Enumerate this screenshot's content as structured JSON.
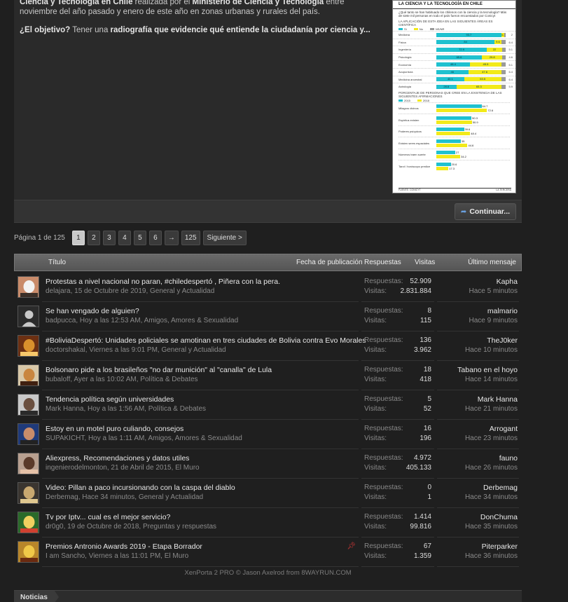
{
  "article": {
    "p1_bold_a": "Ciencia y Tecnología en Chile",
    "p1_text_a": " realizada por el ",
    "p1_bold_b": "Ministerio de Ciencia y Tecnología",
    "p1_text_b": " entre noviembre del año pasado y enero de este año en zonas urbanas y rurales del país.",
    "p2_bold_a": "¿El objetivo?",
    "p2_text_a": " Tener una ",
    "p2_bold_b": "radiografía que evidencie qué entiende la ciudadanía por ciencia y...",
    "infographic": {
      "title": "LA CIENCIA Y LA TECNOLOGÍA EN CHILE",
      "question": "¿Qué tanto se han habituado los chilenos con la ciencia y la tecnología? Más de siete mil personas en todo el país fueron encuestados por Conicyt",
      "section1": "LA APLICACIÓN DE ESTA IDEA EN LAS SIGUIENTES ÁREAS ES CIENTÍFICA",
      "legend": [
        "Sí",
        "No",
        "NS/NR"
      ],
      "rows": [
        {
          "label": "Medicina",
          "si": "93.7",
          "no": "4.3",
          "ns": "2"
        },
        {
          "label": "Física",
          "si": "84",
          "no": "9.6",
          "ns": "6.4"
        },
        {
          "label": "Ingeniería",
          "si": "72.9",
          "no": "22",
          "ns": "5.1"
        },
        {
          "label": "Psicología",
          "si": "65.6",
          "no": "29.8",
          "ns": "4.6"
        },
        {
          "label": "Economía",
          "si": "48.4",
          "no": "45.5",
          "ns": "6.1"
        },
        {
          "label": "Acupuntura",
          "si": "46",
          "no": "47.6",
          "ns": "6.4"
        },
        {
          "label": "Medicina ancestral",
          "si": "40.1",
          "no": "53.5",
          "ns": "6.4"
        },
        {
          "label": "Astrología",
          "si": "28.8",
          "no": "65.3",
          "ns": "5.9"
        }
      ],
      "section2": "PORCENTAJE DE PERSONAS QUE CREE EN LA EXISTENCIA DE LAS SIGUIENTES AFIRMACIONES",
      "legend2": [
        "2015",
        "2018"
      ],
      "beliefs": [
        {
          "label": "Milagros divinos",
          "a": "64.7",
          "b": "72.6"
        },
        {
          "label": "Espíritus existen",
          "a": "50.3",
          "b": "50.9"
        },
        {
          "label": "Poderes psíquicos",
          "a": "39.6",
          "b": "48.4"
        },
        {
          "label": "Existen seres espaciales",
          "a": "35",
          "b": "44.6"
        },
        {
          "label": "Números traen suerte",
          "a": "27",
          "b": "34.2"
        },
        {
          "label": "Tarot / horóscopo predice",
          "a": "20.6",
          "b": "17.3"
        }
      ],
      "foot_left": "FUENTE: CONICYT",
      "foot_right": "LA TERCERA"
    }
  },
  "actions": {
    "continue_label": "Continuar..."
  },
  "pager": {
    "label": "Página 1 de 125",
    "pages": [
      "1",
      "2",
      "3",
      "4",
      "5",
      "6"
    ],
    "arrow": "→",
    "last": "125",
    "next": "Siguiente >"
  },
  "table": {
    "headers": {
      "title": "Título",
      "date": "Fecha de publicación",
      "replies": "Respuestas",
      "views": "Visitas",
      "last": "Último mensaje"
    },
    "replies_label": "Respuestas:",
    "views_label": "Visitas:",
    "threads": [
      {
        "title": "Protestas a nivel nacional no paran, #chiledespertó , Piñera con la pera.",
        "meta": "delajara, 15 de Octubre de 2019, General y Actualidad",
        "replies": "52.909",
        "views": "2.831.884",
        "last_user": "Kapha",
        "last_time": "Hace 5 minutos",
        "pinned": false
      },
      {
        "title": "Se han vengado de alguien?",
        "meta": "badpucca, Hoy a las 12:53 AM, Amigos, Amores & Sexualidad",
        "replies": "8",
        "views": "115",
        "last_user": "malmario",
        "last_time": "Hace 9 minutos",
        "pinned": false
      },
      {
        "title": "#BoliviaDespertó: Unidades policiales se amotinan en tres ciudades de Bolivia contra Evo Morales",
        "meta": "doctorshakal, Viernes a las 9:01 PM, General y Actualidad",
        "replies": "136",
        "views": "3.962",
        "last_user": "TheJ0ker",
        "last_time": "Hace 10 minutos",
        "pinned": false
      },
      {
        "title": "Bolsonaro pide a los brasileños \"no dar munición\" al \"canalla\" de Lula",
        "meta": "bubaloff, Ayer a las 10:02 AM, Política & Debates",
        "replies": "18",
        "views": "418",
        "last_user": "Tabano en el hoyo",
        "last_time": "Hace 14 minutos",
        "pinned": false
      },
      {
        "title": "Tendencia política según universidades",
        "meta": "Mark Hanna, Hoy a las 1:56 AM, Política & Debates",
        "replies": "5",
        "views": "52",
        "last_user": "Mark Hanna",
        "last_time": "Hace 21 minutos",
        "pinned": false
      },
      {
        "title": "Estoy en un motel puro culiando, consejos",
        "meta": "SUPAKICHT, Hoy a las 1:11 AM, Amigos, Amores & Sexualidad",
        "replies": "16",
        "views": "196",
        "last_user": "Arrogant",
        "last_time": "Hace 23 minutos",
        "pinned": false
      },
      {
        "title": "Aliexpress, Recomendaciones y datos utiles",
        "meta": "ingenierodelmonton, 21 de Abril de 2015, El Muro",
        "replies": "4.972",
        "views": "405.133",
        "last_user": "fauno",
        "last_time": "Hace 26 minutos",
        "pinned": false
      },
      {
        "title": "Video: Pillan a paco incursionando con la caspa del diablo",
        "meta": "Derbemag, Hace 34 minutos, General y Actualidad",
        "replies": "0",
        "views": "1",
        "last_user": "Derbemag",
        "last_time": "Hace 34 minutos",
        "pinned": false
      },
      {
        "title": "Tv por Iptv... cual es el mejor servicio?",
        "meta": "dr0g0, 19 de Octubre de 2018, Preguntas y respuestas",
        "replies": "1.414",
        "views": "99.816",
        "last_user": "DonChuma",
        "last_time": "Hace 35 minutos",
        "pinned": false
      },
      {
        "title": "Premios Antronio Awards 2019 - Etapa Borrador",
        "meta": "I am Sancho, Viernes a las 11:01 PM, El Muro",
        "replies": "67",
        "views": "1.359",
        "last_user": "Piterparker",
        "last_time": "Hace 36 minutos",
        "pinned": true
      }
    ]
  },
  "footer": {
    "credit": "XenPorta 2 PRO © Jason Axelrod from 8WAYRUN.COM"
  },
  "tabs": {
    "news": "Noticias"
  },
  "colors": {
    "cyan": "#1fc1cf",
    "yellow": "#f2ea1a",
    "gray": "#9a9a9a",
    "pin": "#e03a3a"
  }
}
